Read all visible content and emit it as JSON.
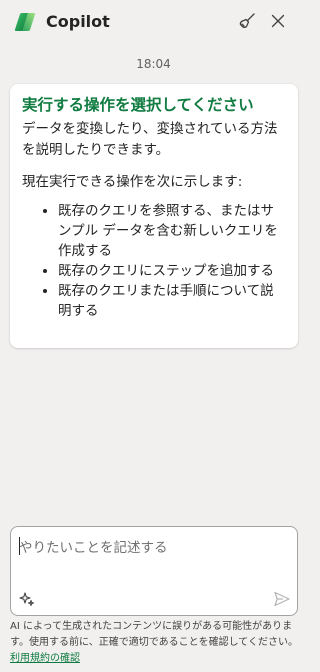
{
  "header": {
    "title": "Copilot",
    "logo_icon": "copilot-logo-icon",
    "new_chat_icon": "broom-icon",
    "close_icon": "close-icon"
  },
  "chat": {
    "timestamp": "18:04",
    "message": {
      "title": "実行する操作を選択してください",
      "intro": "データを変換したり、変換されている方法を説明したりできます。",
      "list_intro": "現在実行できる操作を次に示します:",
      "items": [
        "既存のクエリを参照する、またはサンプル データを含む新しいクエリを作成する",
        "既存のクエリにステップを追加する",
        "既存のクエリまたは手順について説明する"
      ]
    }
  },
  "composer": {
    "placeholder": "やりたいことを記述する",
    "value": "",
    "prompts_icon": "sparkle-icon",
    "send_icon": "send-icon"
  },
  "footer": {
    "disclaimer": "AI によって生成されたコンテンツに誤りがある可能性があります。使用する前に、正確で適切であることを確認してください。",
    "terms_link": "利用規約の確認"
  },
  "colors": {
    "accent": "#107c41",
    "background": "#f1f0ef",
    "card": "#ffffff"
  }
}
